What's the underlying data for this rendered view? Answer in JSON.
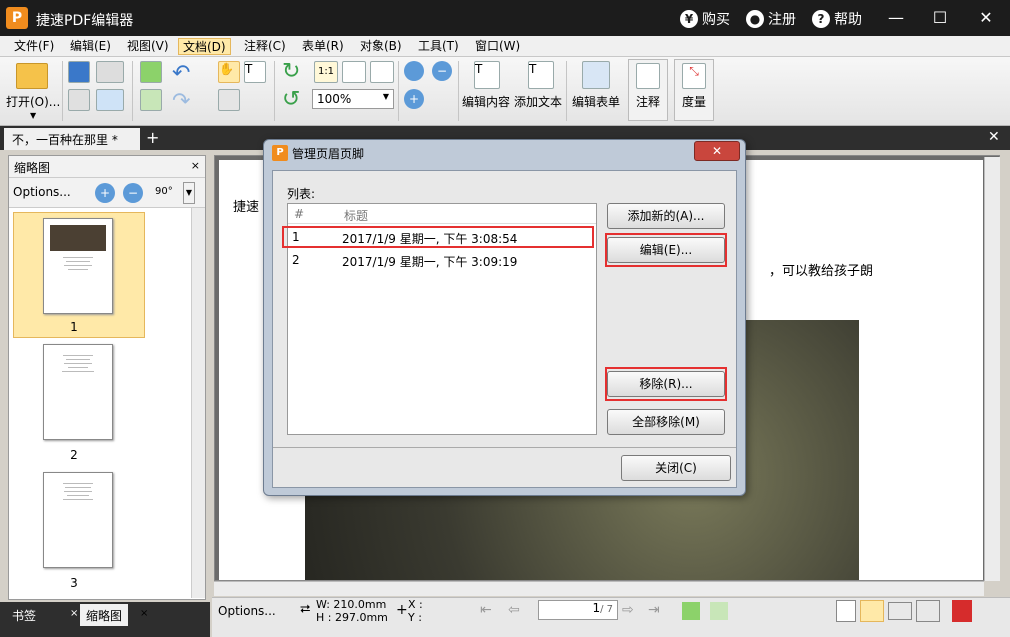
{
  "app": {
    "logo_letter": "P",
    "title": "捷速PDF编辑器",
    "buy": "购买",
    "register": "注册",
    "help": "帮助"
  },
  "menu": [
    "文件(F)",
    "编辑(E)",
    "视图(V)",
    "文档(D)",
    "注释(C)",
    "表单(R)",
    "对象(B)",
    "工具(T)",
    "窗口(W)"
  ],
  "toolbar": {
    "open": "打开(O)...",
    "zoom": "100%",
    "fit_page": "1:1",
    "edit_content": "编辑内容",
    "add_text": "添加文本",
    "edit_form": "编辑表单",
    "annotate": "注释",
    "measure": "度量"
  },
  "doc_tab": "不，一百种在那里 *",
  "left_panel": {
    "title": "缩略图",
    "options": "Options...",
    "rotate": "90°",
    "pages": [
      "1",
      "2",
      "3"
    ],
    "tab_bookmarks": "书签",
    "tab_thumbnails": "缩略图"
  },
  "page": {
    "text_left": "捷速",
    "text_right": "，可以教给孩子朗"
  },
  "status": {
    "options": "Options...",
    "width": "W: 210.0mm",
    "height": "H : 297.0mm",
    "x": "X :",
    "y": "Y :",
    "page_current": "1",
    "page_total": "/ 7"
  },
  "dialog": {
    "title": "管理页眉页脚",
    "list_label": "列表:",
    "col_num": "#",
    "col_title": "标题",
    "rows": [
      {
        "num": "1",
        "title": "2017/1/9 星期一, 下午 3:08:54"
      },
      {
        "num": "2",
        "title": "2017/1/9 星期一, 下午 3:09:19"
      }
    ],
    "add_new": "添加新的(A)...",
    "edit": "编辑(E)...",
    "remove": "移除(R)...",
    "remove_all": "全部移除(M)",
    "close": "关闭(C)"
  },
  "colors": {
    "highlight": "#e53030",
    "brand": "#f08c1e"
  }
}
